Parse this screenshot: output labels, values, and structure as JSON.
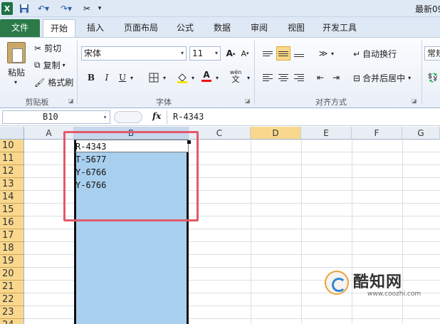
{
  "titlebar": {
    "title": "最新09"
  },
  "ribbon": {
    "tabs": [
      "文件",
      "开始",
      "插入",
      "页面布局",
      "公式",
      "数据",
      "审阅",
      "视图",
      "开发工具"
    ],
    "clipboard": {
      "paste": "粘贴",
      "cut": "剪切",
      "copy": "复制",
      "format_painter": "格式刷",
      "label": "剪贴板"
    },
    "font": {
      "name": "宋体",
      "size": "11",
      "label": "字体",
      "bold": "B",
      "italic": "I",
      "underline": "U",
      "font_color_glyph": "A",
      "wen": "wén"
    },
    "alignment": {
      "wrap_text": "自动换行",
      "merge_center": "合并后居中",
      "label": "对齐方式"
    },
    "number": {
      "format": "常规"
    }
  },
  "formula_bar": {
    "name_box": "B10",
    "fx": "fx",
    "value": "R-4343"
  },
  "grid": {
    "columns": [
      "A",
      "B",
      "C",
      "D",
      "E",
      "F",
      "G"
    ],
    "rows": [
      "10",
      "11",
      "12",
      "13",
      "14",
      "15",
      "16",
      "17",
      "18",
      "19",
      "20",
      "21",
      "22",
      "23",
      "24"
    ],
    "cells": [
      "R-4343",
      "T-5677",
      "Y-6766",
      "Y-6766"
    ]
  },
  "watermark": {
    "name": "酷知网",
    "url": "www.coozhi.com"
  },
  "colors": {
    "accent_file_tab": "#2c7a48",
    "selection": "#a9cfee",
    "header_highlight": "#f9d88e",
    "annotation": "#e25a6a"
  }
}
